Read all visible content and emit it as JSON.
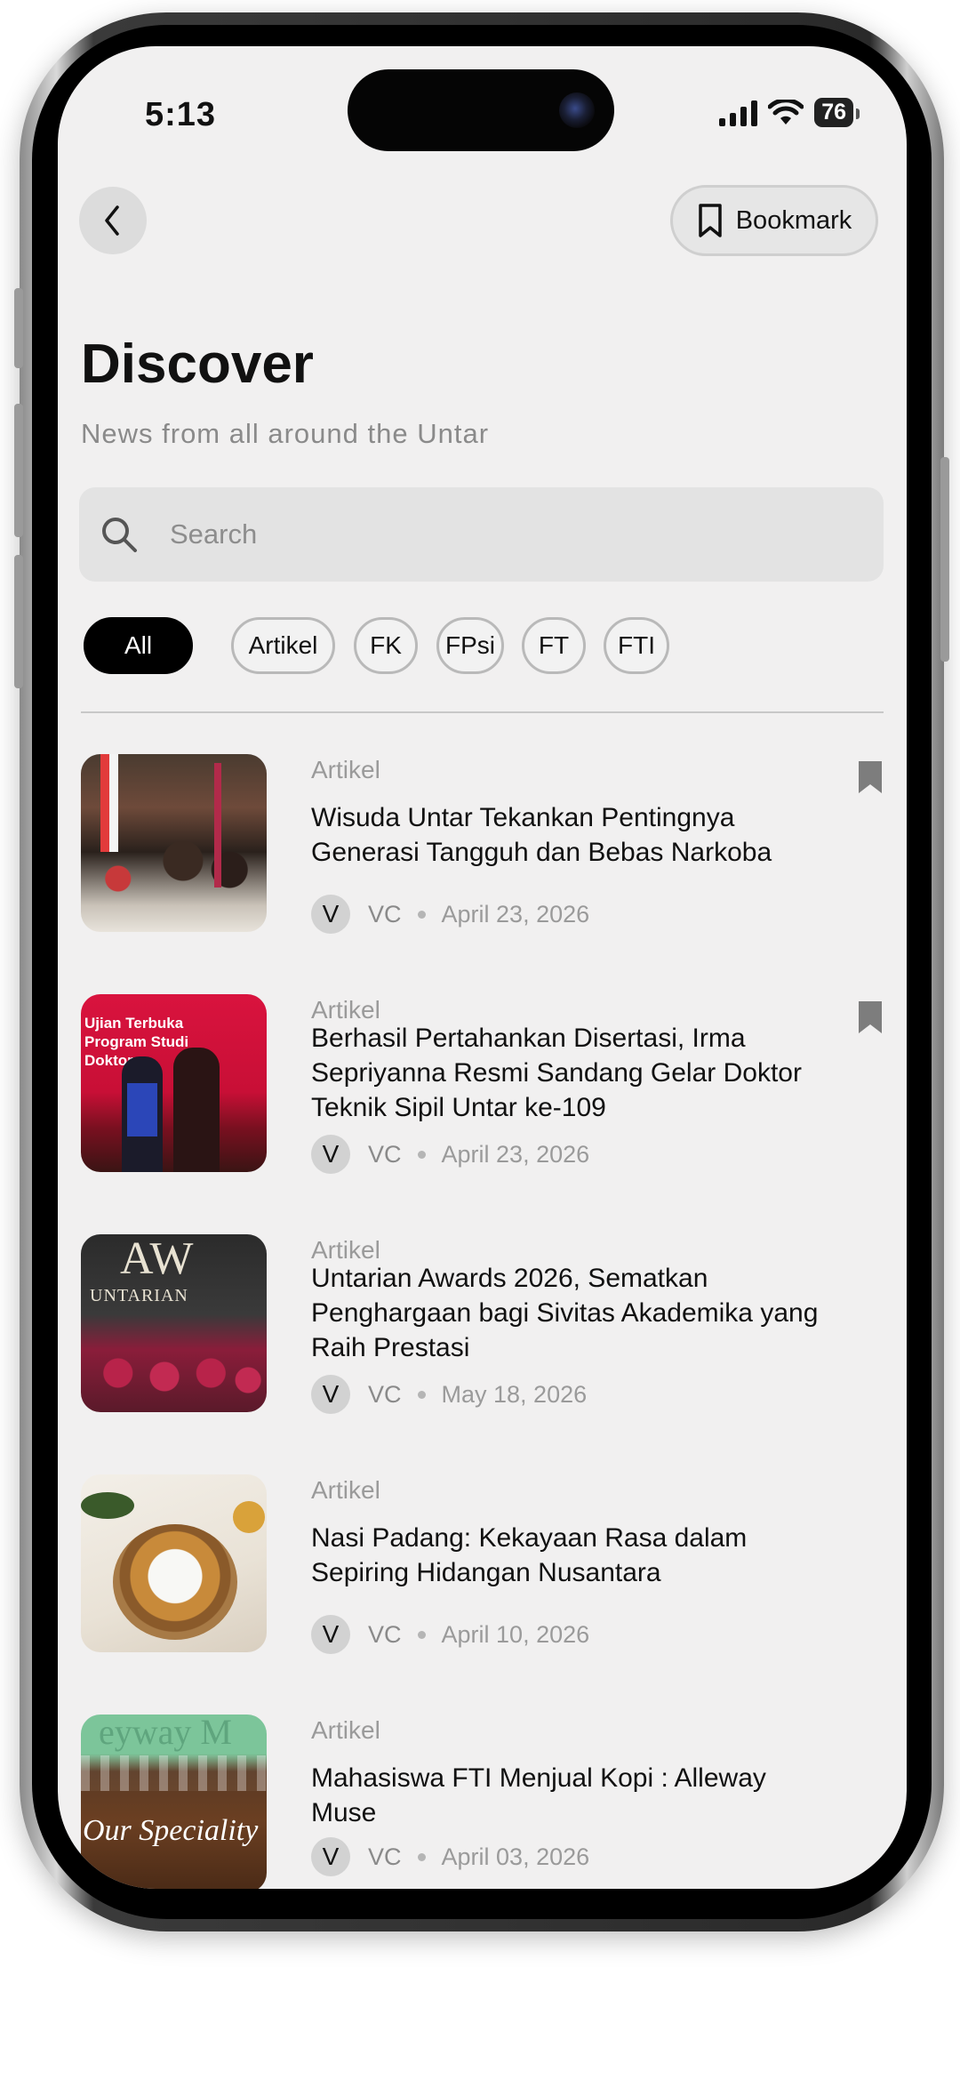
{
  "status_bar": {
    "time": "5:13",
    "battery": "76"
  },
  "header": {
    "bookmark_label": "Bookmark"
  },
  "page": {
    "title": "Discover",
    "subtitle": "News from all around the Untar"
  },
  "search": {
    "placeholder": "Search"
  },
  "categories": [
    "All",
    "Artikel",
    "FK",
    "FPsi",
    "FT",
    "FTI"
  ],
  "selected_category": "All",
  "articles": [
    {
      "category": "Artikel",
      "title": "Wisuda Untar Tekankan Pentingnya Generasi Tangguh dan Bebas Narkoba",
      "avatar": "V",
      "author": "VC",
      "date": "April 23, 2026",
      "bookmarked": true
    },
    {
      "category": "Artikel",
      "title": "Berhasil Pertahankan Disertasi, Irma Sepriyanna Resmi Sandang Gelar Doktor Teknik Sipil Untar ke-109",
      "avatar": "V",
      "author": "VC",
      "date": "April 23, 2026",
      "bookmarked": true,
      "thumb_text": [
        "Ujian Terbuka",
        "Program Studi",
        "Doktor"
      ]
    },
    {
      "category": "Artikel",
      "title": "Untarian Awards 2026, Sematkan Penghargaan bagi Sivitas Akademika yang Raih Prestasi",
      "avatar": "V",
      "author": "VC",
      "date": "May 18, 2026",
      "bookmarked": false,
      "thumb_text": [
        "AW",
        "UNTARIAN"
      ]
    },
    {
      "category": "Artikel",
      "title": "Nasi Padang: Kekayaan Rasa dalam Sepiring Hidangan Nusantara",
      "avatar": "V",
      "author": "VC",
      "date": "April 10, 2026",
      "bookmarked": false
    },
    {
      "category": "Artikel",
      "title": "Mahasiswa FTI Menjual Kopi : Alleway Muse",
      "avatar": "V",
      "author": "VC",
      "date": "April 03, 2026",
      "bookmarked": false,
      "thumb_text": [
        "eyway M",
        "Our Speciality"
      ]
    }
  ],
  "colors": {
    "accent": "#000000",
    "screen_bg": "#f1f0f0",
    "muted": "#9a9a9a"
  }
}
